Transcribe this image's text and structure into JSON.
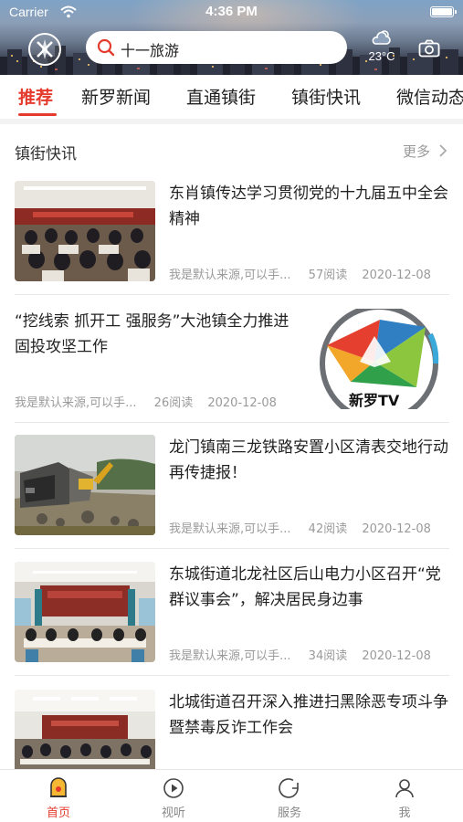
{
  "status_bar": {
    "carrier": "Carrier",
    "time": "4:36 PM"
  },
  "header": {
    "search_text": "十一旅游",
    "weather_temp": "23°C",
    "icons": [
      "app-logo-icon",
      "search-icon",
      "weather-icon",
      "camera-icon"
    ]
  },
  "tabs": [
    {
      "label": "推荐",
      "active": true
    },
    {
      "label": "新罗新闻",
      "active": false
    },
    {
      "label": "直通镇街",
      "active": false
    },
    {
      "label": "镇街快讯",
      "active": false
    },
    {
      "label": "微信动态",
      "active": false
    }
  ],
  "section": {
    "title": "镇街快讯",
    "more_label": "更多"
  },
  "news": [
    {
      "title": "东肖镇传达学习贯彻党的十九届五中全会精神",
      "source": "我是默认来源,可以手...",
      "reads": "57阅读",
      "date": "2020-12-08",
      "image": "meeting-room-photo"
    },
    {
      "title": "“挖线索 抓开工 强服务”大池镇全力推进固投攻坚工作",
      "source": "我是默认来源,可以手...",
      "reads": "26阅读",
      "date": "2020-12-08",
      "image": "xinluo-tv-logo",
      "logo_text": "新罗TV"
    },
    {
      "title": "龙门镇南三龙铁路安置小区清表交地行动再传捷报！",
      "source": "我是默认来源,可以手...",
      "reads": "42阅读",
      "date": "2020-12-08",
      "image": "demolition-site-photo"
    },
    {
      "title": "东城街道北龙社区后山电力小区召开“党群议事会”，解决居民身边事",
      "source": "我是默认来源,可以手...",
      "reads": "34阅读",
      "date": "2020-12-08",
      "image": "meeting-hall-photo"
    },
    {
      "title": "北城街道召开深入推进扫黑除恶专项斗争暨禁毒反诈工作会",
      "image": "conference-photo"
    }
  ],
  "bottom_nav": [
    {
      "label": "首页",
      "icon": "home-icon",
      "active": true
    },
    {
      "label": "视听",
      "icon": "play-icon",
      "active": false
    },
    {
      "label": "服务",
      "icon": "service-icon",
      "active": false
    },
    {
      "label": "我",
      "icon": "user-icon",
      "active": false
    }
  ],
  "colors": {
    "accent": "#e53b2e",
    "text": "#222222",
    "meta": "#9a9a9a",
    "divider": "#e8e8e8"
  }
}
